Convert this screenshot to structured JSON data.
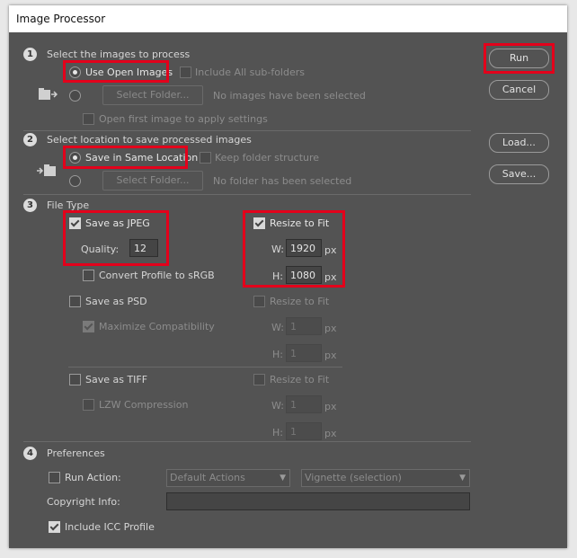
{
  "window": {
    "title": "Image Processor"
  },
  "section1": {
    "number": "1",
    "heading": "Select the images to process",
    "use_open_images": "Use Open Images",
    "include_subfolders": "Include All sub-folders",
    "select_folder": "Select Folder...",
    "folder_status": "No images have been selected",
    "open_first_image": "Open first image to apply settings"
  },
  "section2": {
    "number": "2",
    "heading": "Select location to save processed images",
    "save_same_location": "Save in Same Location",
    "keep_folder_structure": "Keep folder structure",
    "select_folder": "Select Folder...",
    "folder_status": "No folder has been selected"
  },
  "section3": {
    "number": "3",
    "heading": "File Type",
    "jpeg": {
      "label": "Save as JPEG",
      "quality_label": "Quality:",
      "quality_value": "12",
      "convert_profile": "Convert Profile to sRGB",
      "resize": "Resize to Fit",
      "w_label": "W:",
      "w_value": "1920",
      "h_label": "H:",
      "h_value": "1080",
      "unit": "px"
    },
    "psd": {
      "label": "Save as PSD",
      "maximize": "Maximize Compatibility",
      "resize": "Resize to Fit",
      "w_label": "W:",
      "w_value": "1",
      "h_label": "H:",
      "h_value": "1",
      "unit": "px"
    },
    "tiff": {
      "label": "Save as TIFF",
      "lzw": "LZW Compression",
      "resize": "Resize to Fit",
      "w_label": "W:",
      "w_value": "1",
      "h_label": "H:",
      "h_value": "1",
      "unit": "px"
    }
  },
  "section4": {
    "number": "4",
    "heading": "Preferences",
    "run_action": "Run Action:",
    "action_set": "Default Actions",
    "action": "Vignette (selection)",
    "copyright_label": "Copyright Info:",
    "copyright_value": "",
    "include_icc": "Include ICC Profile"
  },
  "buttons": {
    "run": "Run",
    "cancel": "Cancel",
    "load": "Load...",
    "save": "Save..."
  },
  "colors": {
    "background": "#535353",
    "highlight": "#e3001b",
    "titlebar": "#ffffff"
  }
}
